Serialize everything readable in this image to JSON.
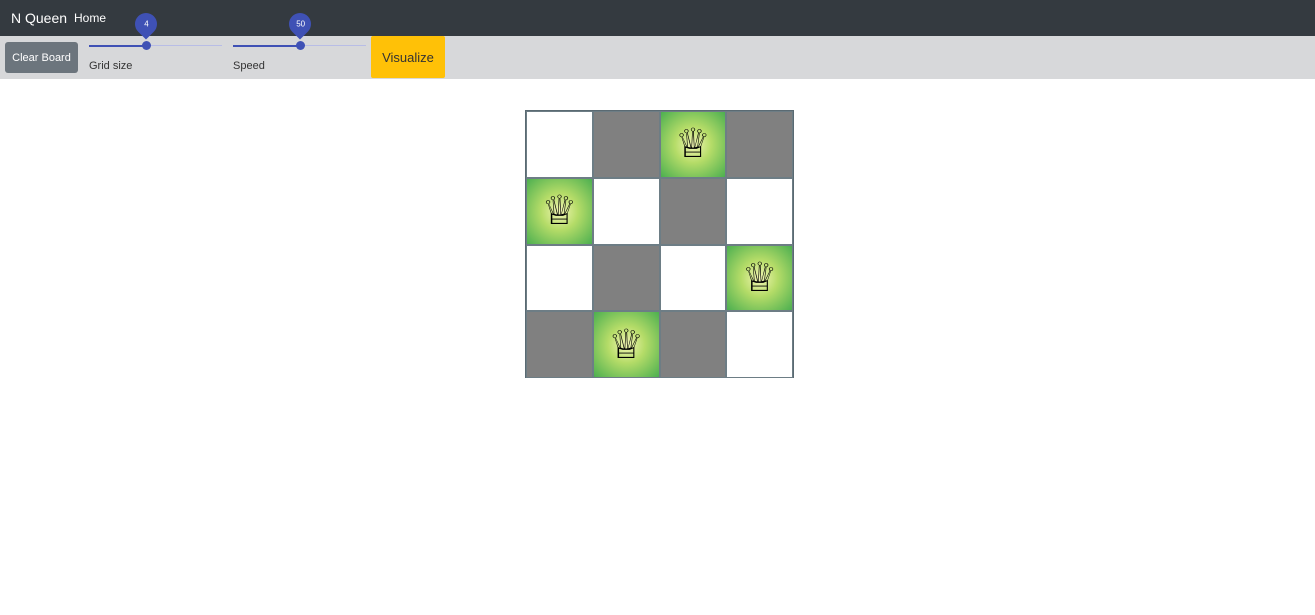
{
  "navbar": {
    "brand": "N Queen",
    "home": "Home"
  },
  "toolbar": {
    "clear_label": "Clear Board",
    "grid_size": {
      "label": "Grid size",
      "value": "4",
      "fraction": 0.43
    },
    "speed": {
      "label": "Speed",
      "value": "50",
      "fraction": 0.5
    },
    "visualize_label": "Visualize"
  },
  "board": {
    "size": 4,
    "queens": [
      2,
      0,
      3,
      1
    ],
    "cells": [
      [
        "white",
        "dark",
        "queen",
        "dark"
      ],
      [
        "queen",
        "white",
        "dark",
        "white"
      ],
      [
        "white",
        "dark",
        "white",
        "queen"
      ],
      [
        "dark",
        "queen",
        "dark",
        "white"
      ]
    ],
    "queen_glyph": "♕",
    "queen_icon_name": "queen-icon"
  },
  "colors": {
    "navbar": "#343a40",
    "toolbar": "#d7d8da",
    "slider": "#3f51b5",
    "visualize": "#ffc107",
    "clear": "#6c757d",
    "dark_square": "#808080",
    "queen_highlight": "#4caf50"
  }
}
